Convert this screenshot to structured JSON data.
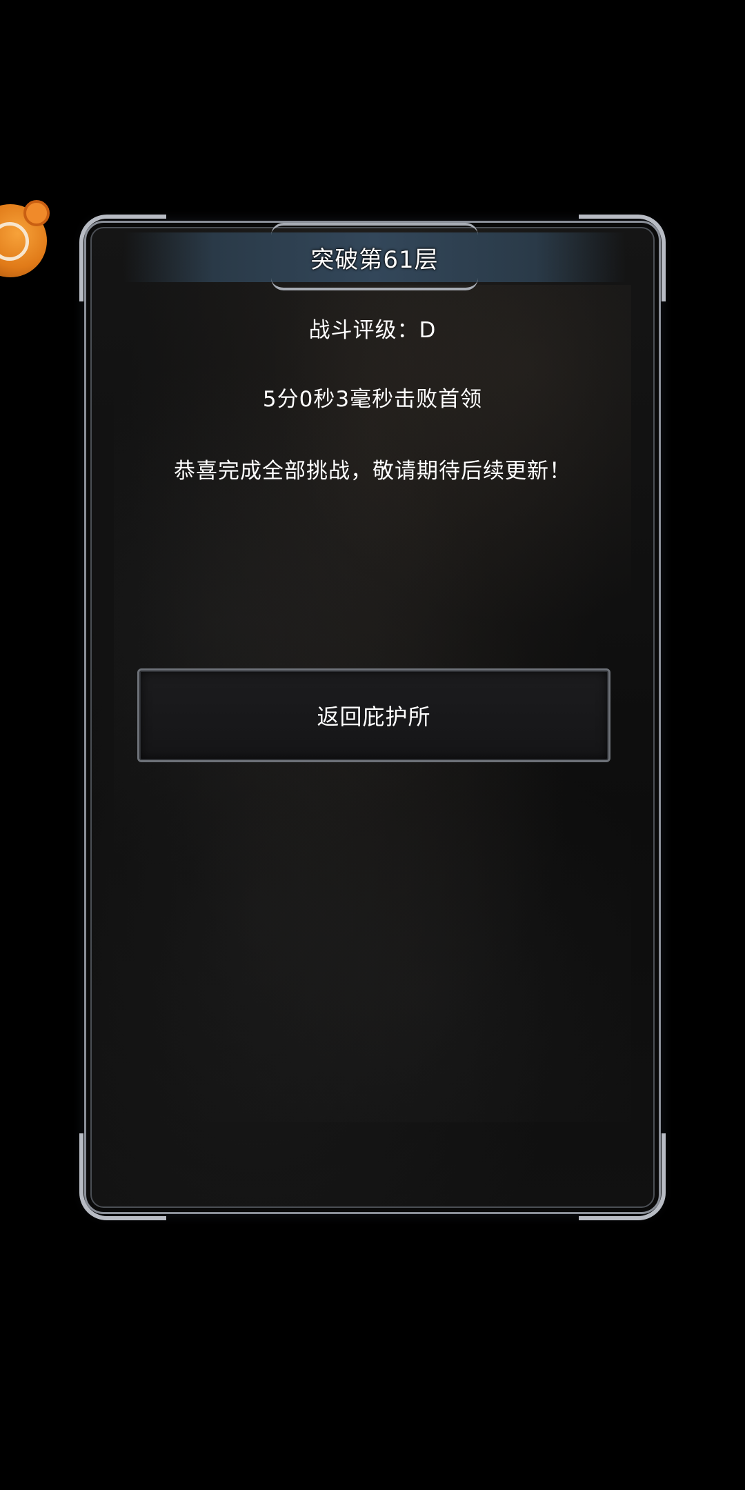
{
  "floating_assistant": {
    "icon": "gamepad-bubble-icon"
  },
  "dialog": {
    "title": "突破第61层",
    "battle_rating": "战斗评级：D",
    "clear_time": "5分0秒3毫秒击败首领",
    "congrats_message": "恭喜完成全部挑战，敬请期待后续更新！",
    "return_button_label": "返回庇护所"
  },
  "colors": {
    "background": "#000000",
    "panel_border": "#8a8f98",
    "title_banner": "#33475a",
    "assistant_bubble": "#e07a18",
    "text": "#ffffff"
  }
}
